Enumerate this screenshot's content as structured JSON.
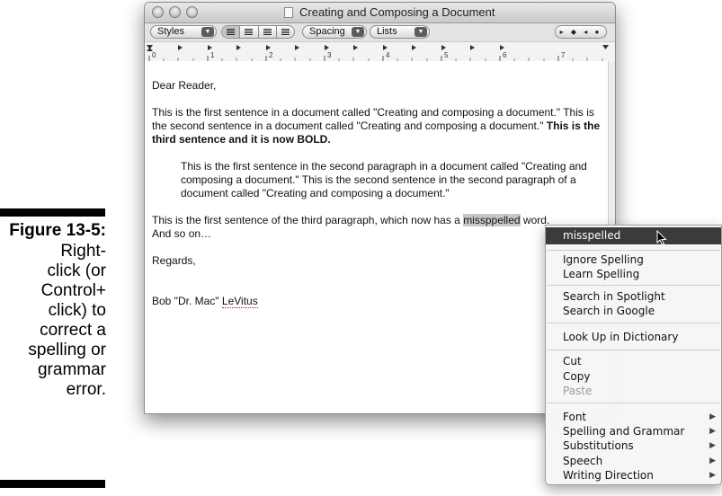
{
  "caption": {
    "figure": "Figure 13-5:",
    "lines": [
      "Right-",
      "click (or",
      "Control+",
      "click) to",
      "correct a",
      "spelling or",
      "grammar",
      "error."
    ]
  },
  "window": {
    "title": "Creating and Composing a Document"
  },
  "toolbar": {
    "styles_label": "Styles",
    "spacing_label": "Spacing",
    "lists_label": "Lists",
    "align_buttons": [
      "align-left",
      "align-center",
      "justify",
      "align-right"
    ],
    "nav_glyphs": "▸ ◆ ◂ ●"
  },
  "ruler": {
    "numbers": [
      "0",
      "1",
      "2",
      "3",
      "4",
      "5",
      "6",
      "7"
    ]
  },
  "document": {
    "greeting": "Dear Reader,",
    "para1_normal": "This is the first sentence in a document called \"Creating and composing a document.\" This is the second sentence in a document called \"Creating and composing a document.\" ",
    "para1_bold": "This is the third sentence and it is now BOLD.",
    "para2": "This is the first sentence in the second paragraph in a document called \"Creating and composing a document.\" This is the second sentence in the second paragraph of a document called \"Creating and composing a document.\"",
    "para3_before": " This is the first sentence of the third paragraph, which now has a ",
    "para3_misspelled": "missppelled",
    "para3_after": " word.",
    "para3_line2": "And so on…",
    "closing": "Regards,",
    "signature_before": "Bob \"Dr. Mac\" ",
    "signature_name": "LeVitus"
  },
  "context_menu": {
    "suggestion": "misspelled",
    "ignore_spelling": "Ignore Spelling",
    "learn_spelling": "Learn Spelling",
    "search_spotlight": "Search in Spotlight",
    "search_google": "Search in Google",
    "look_up": "Look Up in Dictionary",
    "cut": "Cut",
    "copy": "Copy",
    "paste": "Paste",
    "font": "Font",
    "spelling_grammar": "Spelling and Grammar",
    "substitutions": "Substitutions",
    "speech": "Speech",
    "writing_direction": "Writing Direction",
    "submenu_arrow": "▶"
  }
}
